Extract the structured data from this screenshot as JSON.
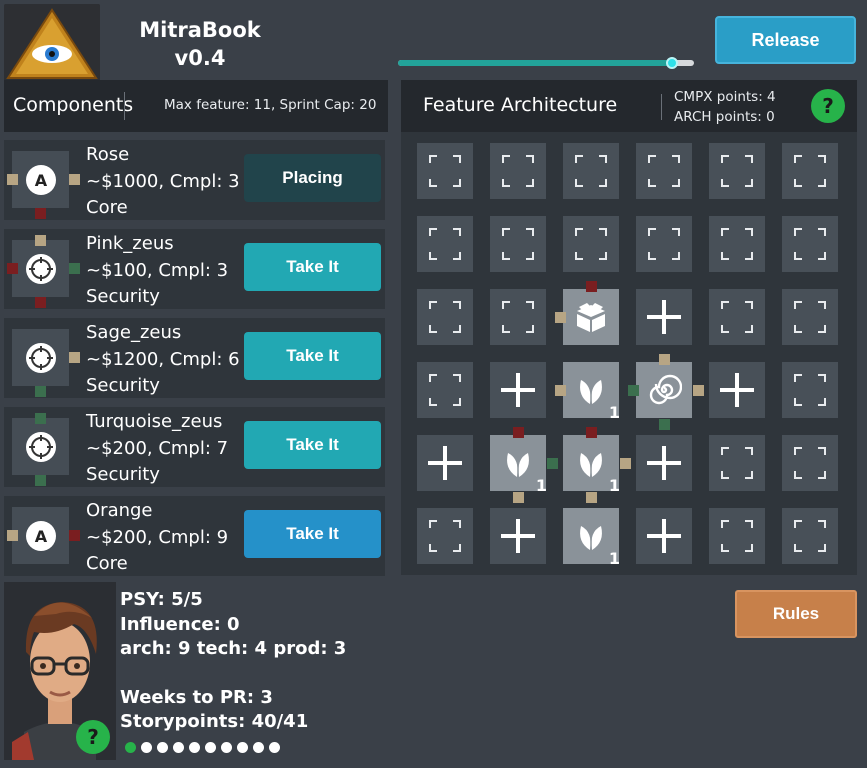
{
  "app": {
    "name": "MitraBook",
    "version": "v0.4",
    "logo_icon": "eye-pyramid-icon"
  },
  "header": {
    "progress_fraction": 0.96,
    "release_label": "Release"
  },
  "components": {
    "title": "Components",
    "subtitle": "Max feature: 11, Sprint Cap: 20",
    "items": [
      {
        "name": "Rose",
        "cost": "~$1000, Cmpl: 3",
        "type": "Core",
        "icon": "A",
        "button": "Placing",
        "state": "placing"
      },
      {
        "name": "Pink_zeus",
        "cost": "~$100, Cmpl: 3",
        "type": "Security",
        "icon": "crosshair",
        "button": "Take It",
        "state": "available"
      },
      {
        "name": "Sage_zeus",
        "cost": "~$1200, Cmpl: 6",
        "type": "Security",
        "icon": "crosshair",
        "button": "Take It",
        "state": "available"
      },
      {
        "name": "Turquoise_zeus",
        "cost": "~$200, Cmpl: 7",
        "type": "Security",
        "icon": "crosshair",
        "button": "Take It",
        "state": "available"
      },
      {
        "name": "Orange",
        "cost": "~$200, Cmpl: 9",
        "type": "Core",
        "icon": "A",
        "button": "Take It",
        "state": "hover"
      }
    ]
  },
  "architecture": {
    "title": "Feature Architecture",
    "cmpx_points": "CMPX points: 4",
    "arch_points": "ARCH points: 0",
    "help_label": "?",
    "grid": [
      [
        "empty",
        "empty",
        "empty",
        "empty",
        "empty",
        "empty"
      ],
      [
        "empty",
        "empty",
        "empty",
        "empty",
        "empty",
        "empty"
      ],
      [
        "empty",
        "empty",
        "box",
        "plus",
        "empty",
        "empty"
      ],
      [
        "empty",
        "plus",
        "leaf",
        "spiral",
        "plus",
        "empty"
      ],
      [
        "plus",
        "leaf",
        "leaf",
        "plus",
        "empty",
        "empty"
      ],
      [
        "empty",
        "plus",
        "leaf",
        "plus",
        "empty",
        "empty"
      ]
    ],
    "leaf_count": "1"
  },
  "player": {
    "psy": "PSY: 5/5",
    "influence": "Influence: 0",
    "skills": "arch: 9 tech: 4 prod: 3",
    "weeks": "Weeks to PR: 3",
    "storypoints": "Storypoints: 40/41",
    "help_label": "?",
    "dots_total": 10,
    "dots_active": 1
  },
  "rules_label": "Rules",
  "colors": {
    "accent_teal": "#22a8b3",
    "release_blue": "#2a9ec7",
    "rules_orange": "#c7804a",
    "help_green": "#27b34a"
  }
}
